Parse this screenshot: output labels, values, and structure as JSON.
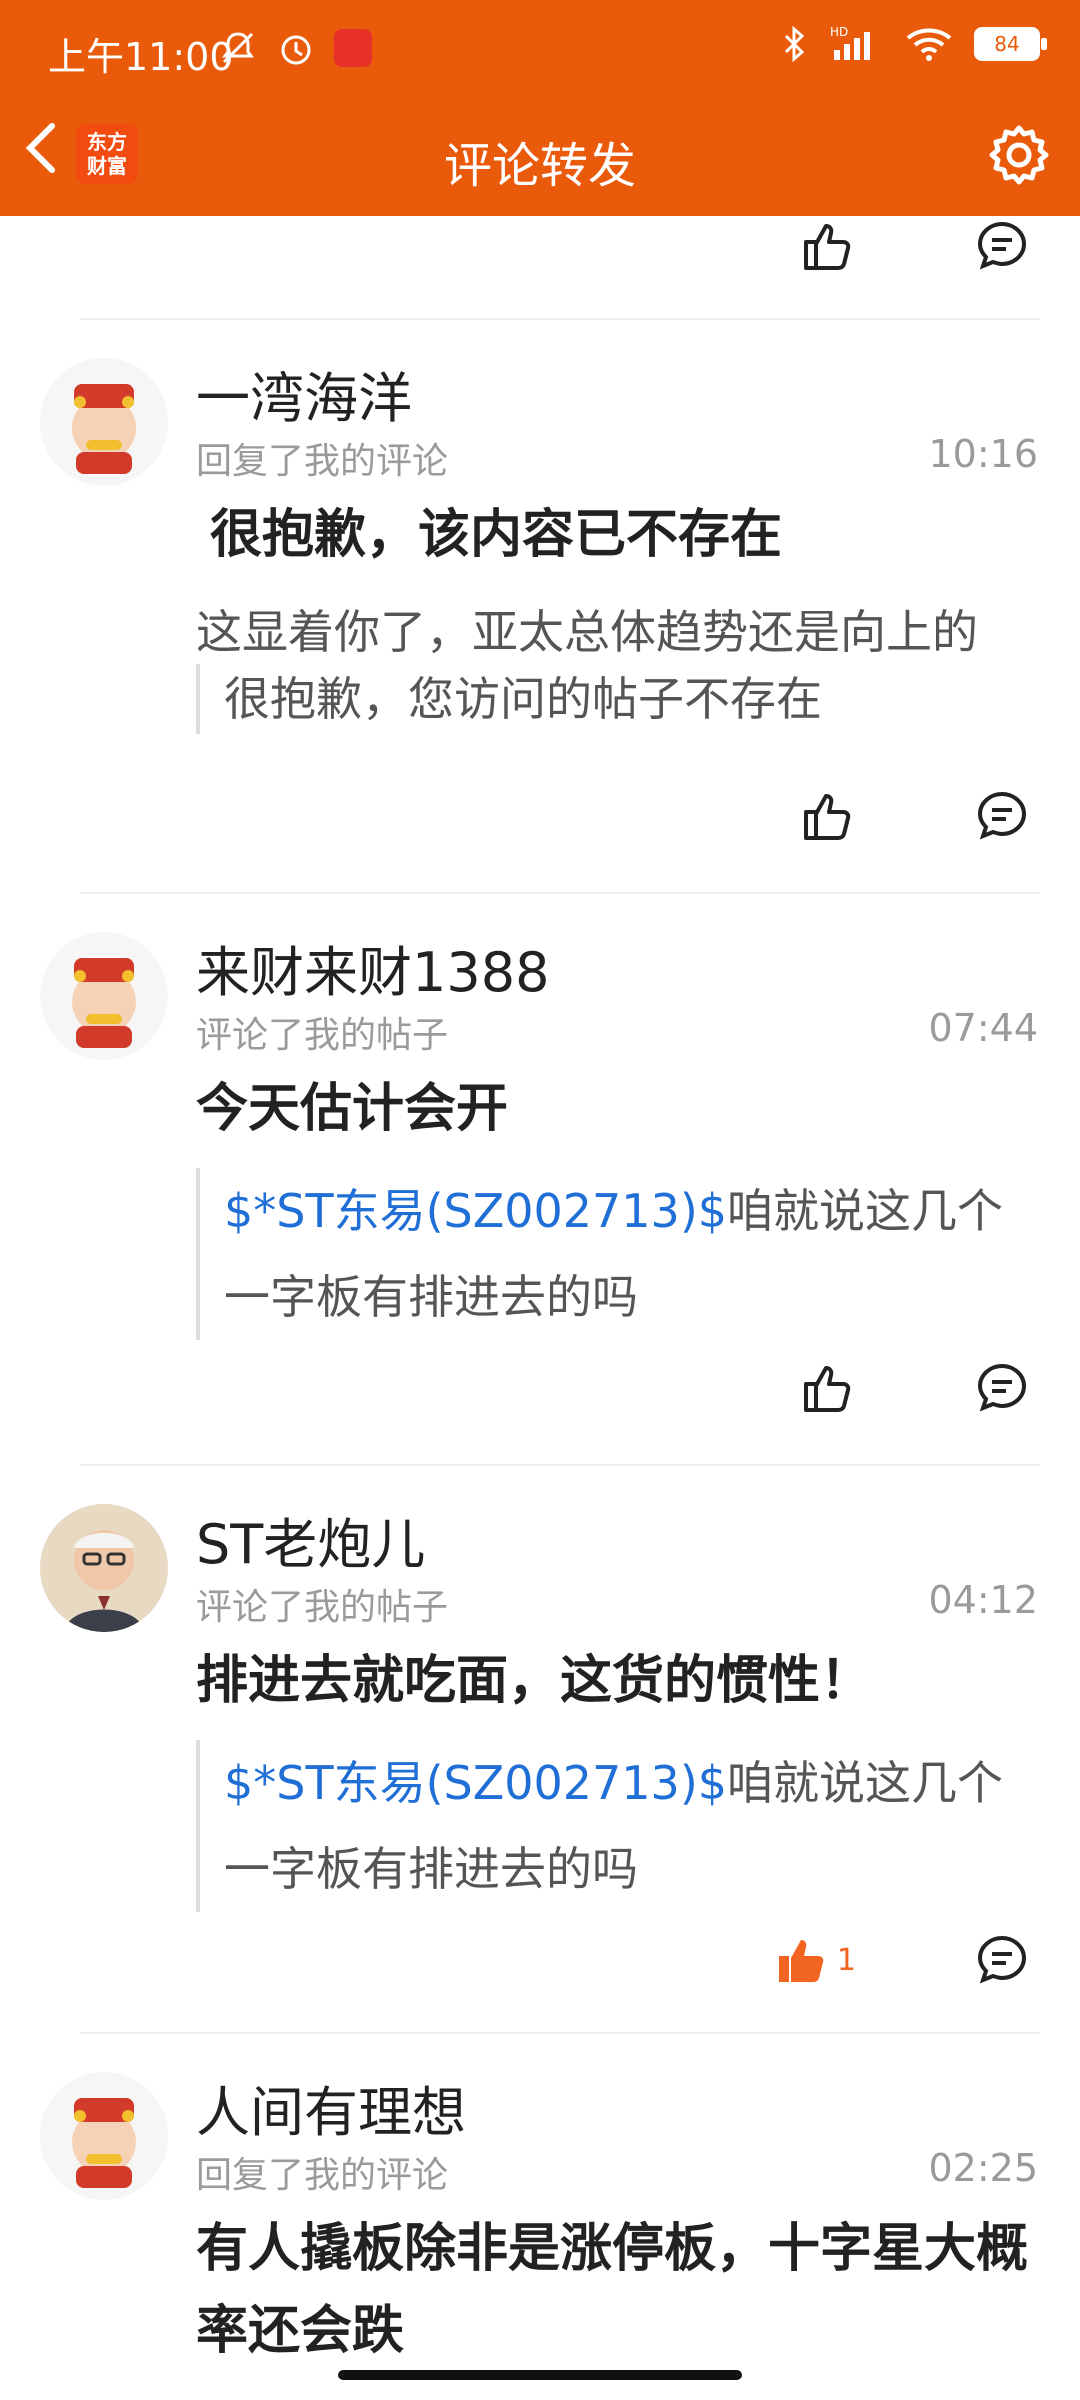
{
  "status": {
    "time": "上午11:00",
    "battery": "84",
    "network": "HD"
  },
  "header": {
    "title": "评论转发",
    "app_logo_line1": "东方",
    "app_logo_line2": "财富"
  },
  "comments": [
    {
      "user": "一湾海洋",
      "action": "回复了我的评论",
      "time": "10:16",
      "content": "很抱歉，该内容已不存在",
      "preview": "这显着你了，亚太总体趋势还是向上的",
      "quote": "很抱歉，您访问的帖子不存在"
    },
    {
      "user": "来财来财1388",
      "action": "评论了我的帖子",
      "time": "07:44",
      "content": "今天估计会开",
      "quote_link": "$*ST东易(SZ002713)$",
      "quote_rest": "咱就说这几个一字板有排进去的吗"
    },
    {
      "user": "ST老炮儿",
      "action": "评论了我的帖子",
      "time": "04:12",
      "content": "排进去就吃面，这货的惯性！",
      "quote_link": "$*ST东易(SZ002713)$",
      "quote_rest": "咱就说这几个一字板有排进去的吗",
      "like_count": "1"
    },
    {
      "user": "人间有理想",
      "action": "回复了我的评论",
      "time": "02:25",
      "content": "有人撬板除非是涨停板，十字星大概率还会跌"
    }
  ],
  "colors": {
    "accent": "#ea5a0b",
    "link": "#1f6fd6",
    "liked": "#f26520"
  }
}
